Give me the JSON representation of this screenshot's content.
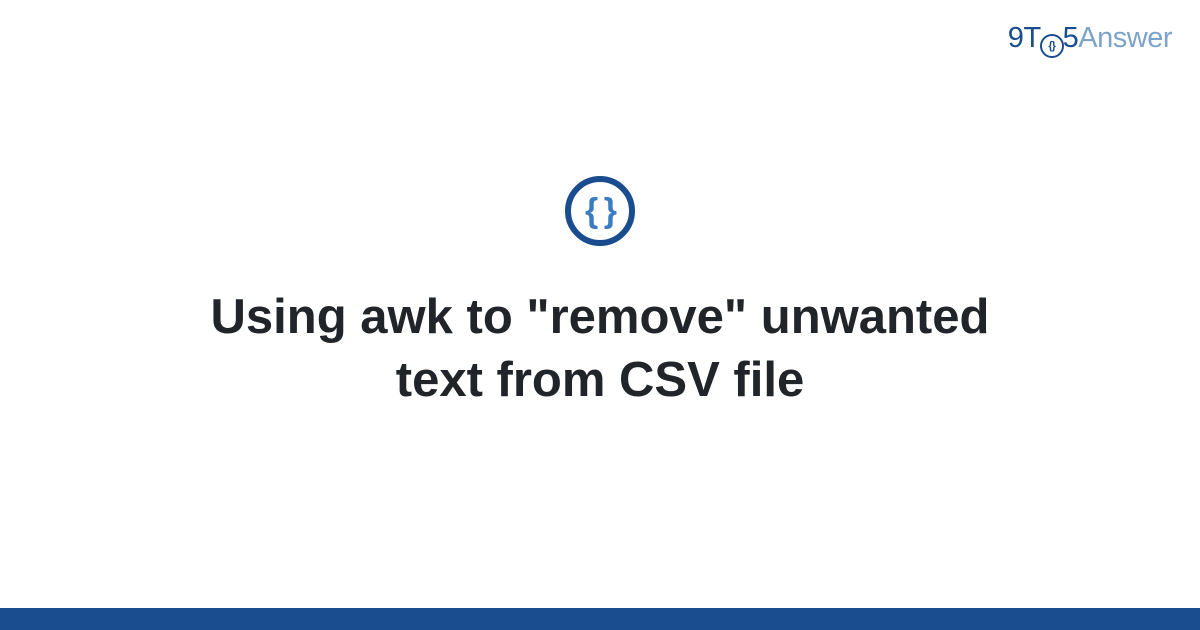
{
  "logo": {
    "nine": "9",
    "t": "T",
    "o_inner": "{}",
    "five": "5",
    "answer": "Answer"
  },
  "badge": {
    "symbol": "{ }"
  },
  "title": "Using awk to \"remove\" unwanted text from CSV file",
  "colors": {
    "brand_primary": "#1a4d8f",
    "brand_light": "#7da3cc",
    "brand_mid": "#3b7bbf",
    "text": "#212529"
  }
}
